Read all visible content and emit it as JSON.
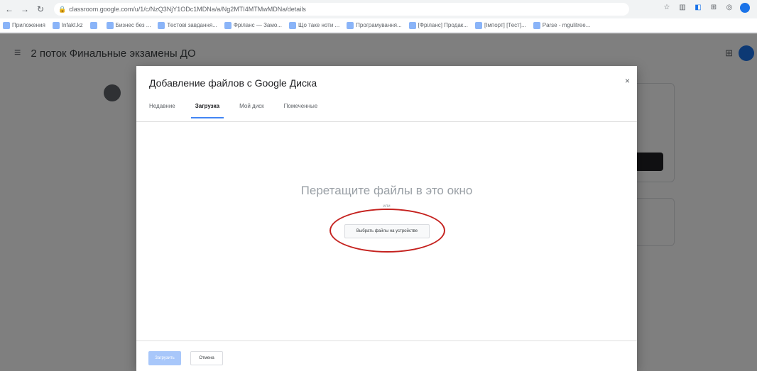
{
  "browser": {
    "url": "classroom.google.com/u/1/c/NzQ3NjY1ODc1MDNa/a/Ng2MTI4MTMwMDNa/details",
    "bookmarks": [
      {
        "label": "Приложения",
        "icon": "apps-icon"
      },
      {
        "label": "Infakt.kz",
        "icon": "bookmark-icon"
      },
      {
        "label": "",
        "icon": "globe-icon"
      },
      {
        "label": "Бизнес без ...",
        "icon": "bookmark-icon"
      },
      {
        "label": "Тестові завдання...",
        "icon": "bookmark-icon"
      },
      {
        "label": "Фріланс — Замо...",
        "icon": "bookmark-icon"
      },
      {
        "label": "Що таке ноти ...",
        "icon": "bookmark-icon"
      },
      {
        "label": "Програмування...",
        "icon": "bookmark-icon"
      },
      {
        "label": "[Фріланс] Продак...",
        "icon": "bookmark-icon"
      },
      {
        "label": "[Імпорт] [Тест]...",
        "icon": "bookmark-icon"
      },
      {
        "label": "Parse - mgulitree...",
        "icon": "github-icon"
      }
    ]
  },
  "page": {
    "course_title": "2 поток Финальные экзамены ДО"
  },
  "dialog": {
    "title": "Добавление файлов с Google Диска",
    "tabs": [
      {
        "label": "Недавние",
        "active": false
      },
      {
        "label": "Загрузка",
        "active": true
      },
      {
        "label": "Мой диск",
        "active": false
      },
      {
        "label": "Помеченные",
        "active": false
      }
    ],
    "drop_text": "Перетащите файлы в это окно",
    "or_text": "или",
    "select_button": "Выбрать файлы на устройстве",
    "upload_button": "Загрузить",
    "cancel_button": "Отмена",
    "highlight_color": "#c5221f",
    "active_tab_color": "#4285f4"
  }
}
